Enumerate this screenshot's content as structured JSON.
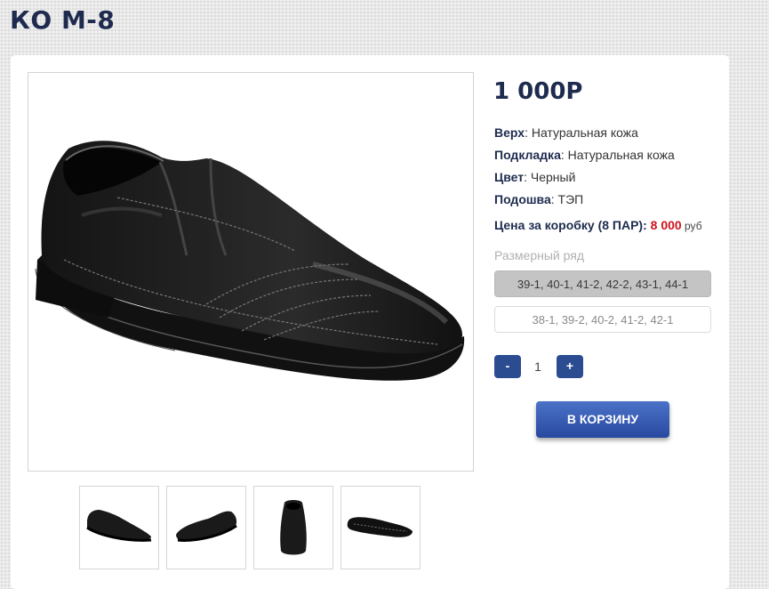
{
  "page": {
    "title": "КО М-8"
  },
  "product": {
    "price": "1 000Р",
    "specs": [
      {
        "label": "Верх",
        "value": ": Натуральная кожа"
      },
      {
        "label": "Подкладка",
        "value": ": Натуральная кожа"
      },
      {
        "label": "Цвет",
        "value": ": Черный"
      },
      {
        "label": "Подошва",
        "value": ": ТЭП"
      }
    ],
    "box_price": {
      "label": "Цена за коробку (8 ПАР): ",
      "value": "8 000",
      "currency": " руб"
    },
    "size_range_label": "Размерный ряд",
    "size_options": [
      "39-1, 40-1, 41-2, 42-2, 43-1, 44-1",
      "38-1, 39-2, 40-2, 41-2, 42-1"
    ],
    "selected_size_option": 0,
    "quantity": {
      "minus": "-",
      "value": "1",
      "plus": "+"
    },
    "cart_button": "В КОРЗИНУ"
  },
  "colors": {
    "accent": "#2c4c92",
    "title": "#1e2b4f",
    "price_red": "#d0121b"
  }
}
